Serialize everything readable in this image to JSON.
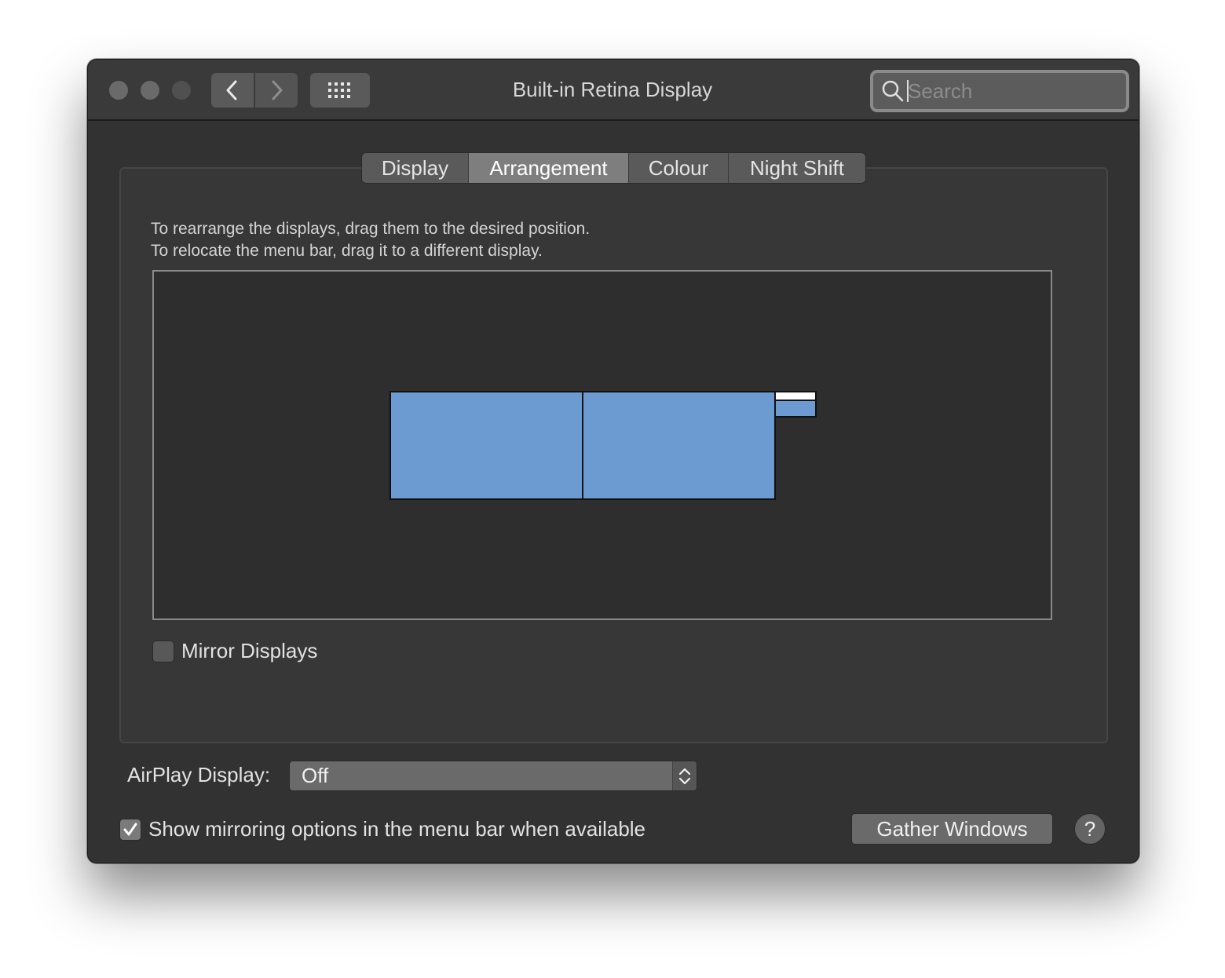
{
  "window": {
    "title": "Built-in Retina Display"
  },
  "titlebar": {
    "traffic_lights": [
      "close-button",
      "minimize-button",
      "zoom-button"
    ],
    "back_icon": "chevron-left-icon",
    "forward_icon": "chevron-right-icon",
    "grid_icon": "grid-icon"
  },
  "search": {
    "placeholder": "Search",
    "value": "",
    "icon": "search-icon"
  },
  "tabs": [
    {
      "label": "Display",
      "active": false
    },
    {
      "label": "Arrangement",
      "active": true
    },
    {
      "label": "Colour",
      "active": false
    },
    {
      "label": "Night Shift",
      "active": false
    }
  ],
  "instructions": {
    "line1": "To rearrange the displays, drag them to the desired position.",
    "line2": "To relocate the menu bar, drag it to a different display."
  },
  "arrangement": {
    "monitor_color": "#6c9bd2",
    "displays": [
      {
        "name": "display-1",
        "has_menu_bar": false
      },
      {
        "name": "display-2",
        "has_menu_bar": false
      },
      {
        "name": "display-3",
        "has_menu_bar": true
      }
    ]
  },
  "mirror_displays": {
    "label": "Mirror Displays",
    "checked": false
  },
  "airplay": {
    "label": "AirPlay Display:",
    "value": "Off"
  },
  "show_mirroring": {
    "label": "Show mirroring options in the menu bar when available",
    "checked": true
  },
  "buttons": {
    "gather_windows": "Gather Windows",
    "help": "?"
  }
}
